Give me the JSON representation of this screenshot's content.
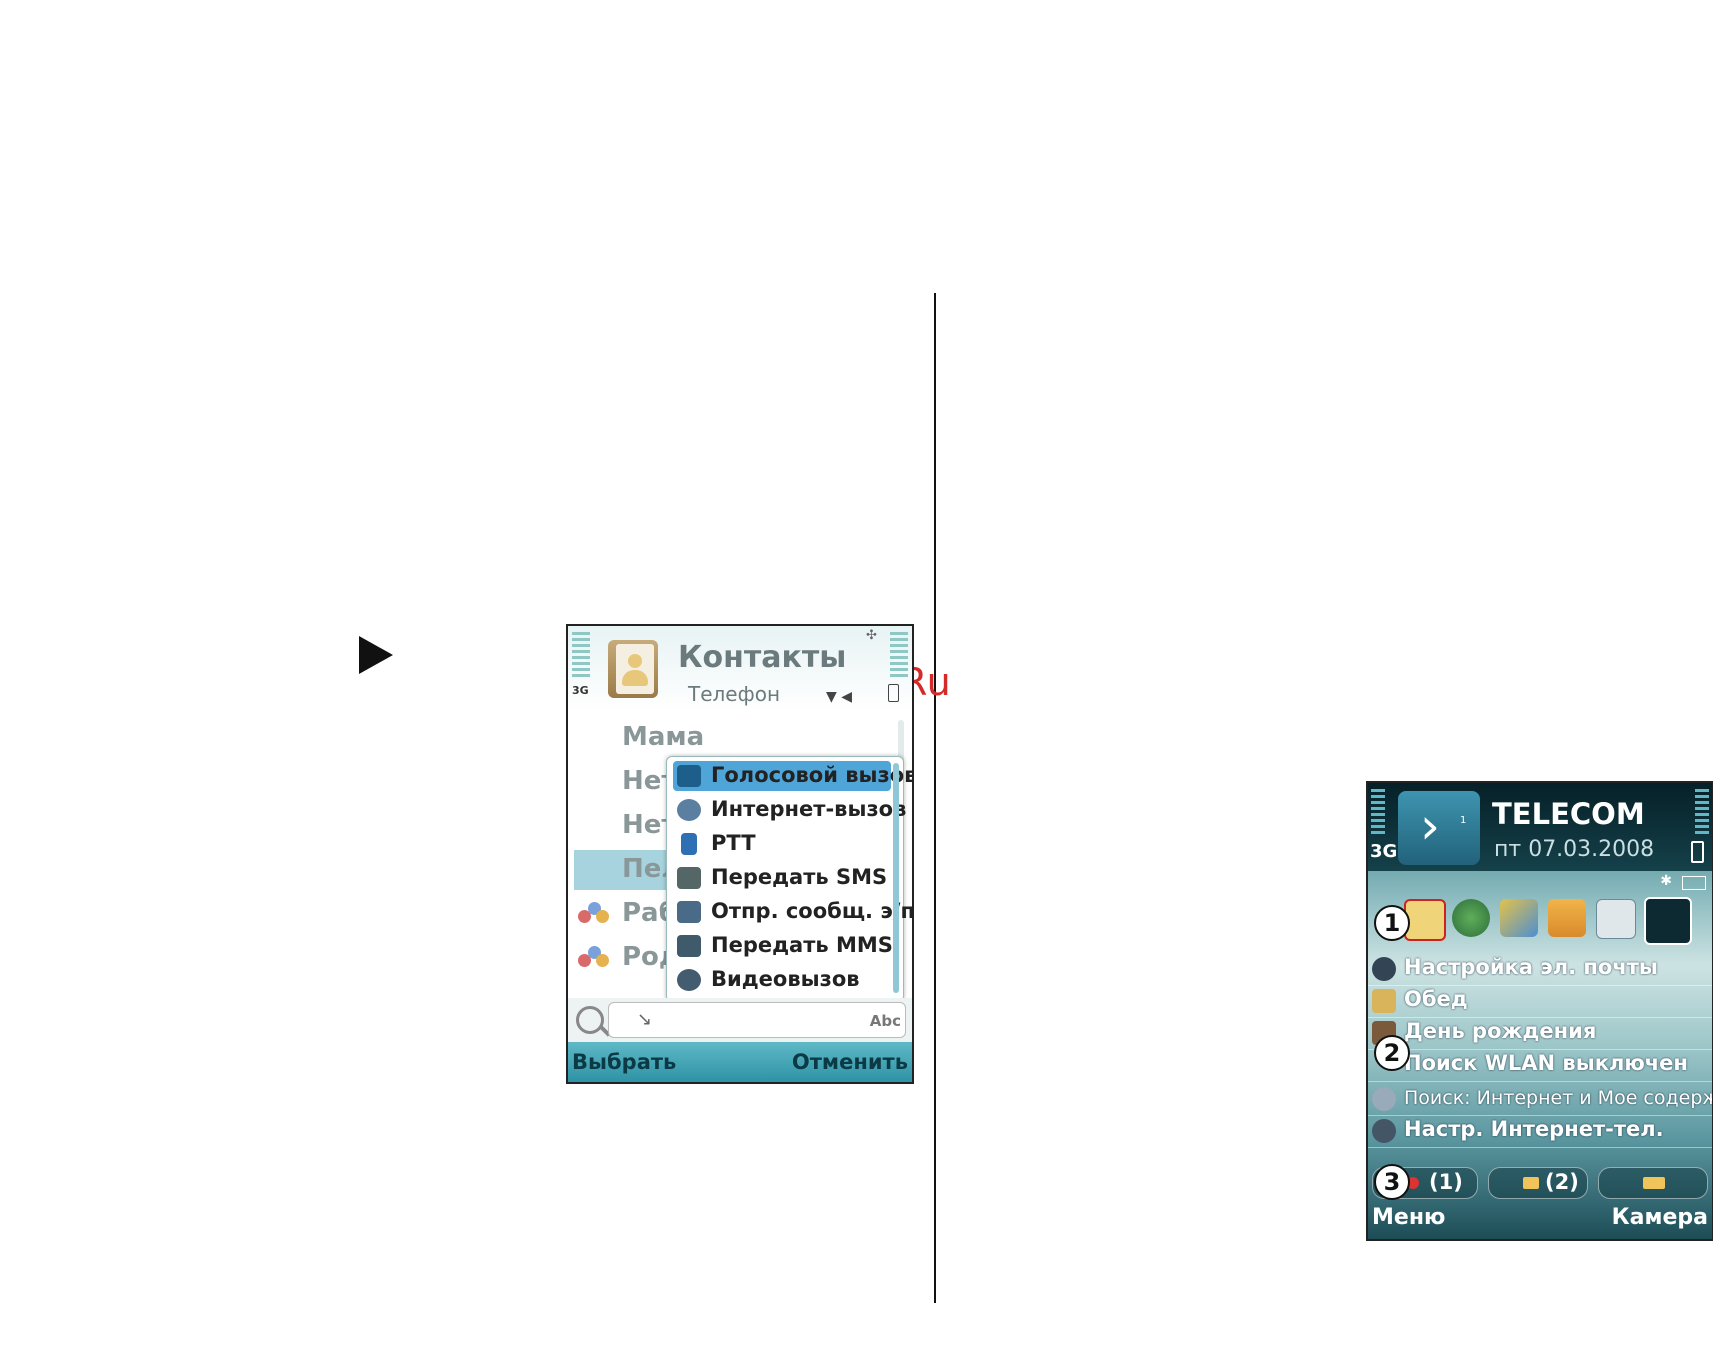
{
  "watermark": "McGrp.Ru",
  "contacts_screen": {
    "network": "3G",
    "title": "Контакты",
    "subtitle": "Телефон",
    "list": [
      {
        "label": "Мама",
        "icon": ""
      },
      {
        "label": "Нет",
        "icon": ""
      },
      {
        "label": "Нет",
        "icon": ""
      },
      {
        "label": "Пел",
        "icon": "",
        "selected": true
      },
      {
        "label": "Раб",
        "icon": "group-icon"
      },
      {
        "label": "Род",
        "icon": "group-icon"
      }
    ],
    "popup_menu": [
      {
        "label": "Голосовой вызов",
        "icon": "phone-icon",
        "highlighted": true
      },
      {
        "label": "Интернет-вызов",
        "icon": "internet-call-icon"
      },
      {
        "label": "PTT",
        "icon": "ptt-icon"
      },
      {
        "label": "Передать SMS",
        "icon": "sms-icon"
      },
      {
        "label": "Отпр. сообщ. э/п",
        "icon": "email-icon"
      },
      {
        "label": "Передать MMS",
        "icon": "mms-icon"
      },
      {
        "label": "Видеовызов",
        "icon": "video-call-icon"
      }
    ],
    "search_input_mode": "Abc",
    "softkey_left": "Выбрать",
    "softkey_right": "Отменить"
  },
  "standby_screen": {
    "network": "3G",
    "operator": "TELECOM",
    "date": "пт 07.03.2008",
    "shortcut_icons": [
      "mail-icon",
      "globe-icon",
      "text-edit-icon",
      "gallery-icon",
      "folder-icon",
      "switch-icon"
    ],
    "rows": [
      {
        "label": "Настройка эл. почты",
        "icon": "at-icon"
      },
      {
        "label": "Обед",
        "icon": "note-icon"
      },
      {
        "label": "День рождения",
        "icon": "calendar-icon"
      },
      {
        "label": "Поиск WLAN выключен",
        "icon": "wlan-icon"
      },
      {
        "label": "Поиск: Интернет и Мое содерж.",
        "icon": "search-icon"
      },
      {
        "label": "Настр. Интернет-тел.",
        "icon": "internet-phone-icon"
      }
    ],
    "notifications": [
      {
        "label": "(1)",
        "icon": "missed-call-icon"
      },
      {
        "label": "(2)",
        "icon": "message-icon"
      },
      {
        "label": "",
        "icon": "voicemail-icon"
      }
    ],
    "callouts": [
      "1",
      "2",
      "3"
    ],
    "softkey_left": "Меню",
    "softkey_right": "Камера"
  },
  "colors": {
    "highlight": "#4fa4d8",
    "softkey_bar": "#2e93a6",
    "watermark": "#d42a2a"
  }
}
